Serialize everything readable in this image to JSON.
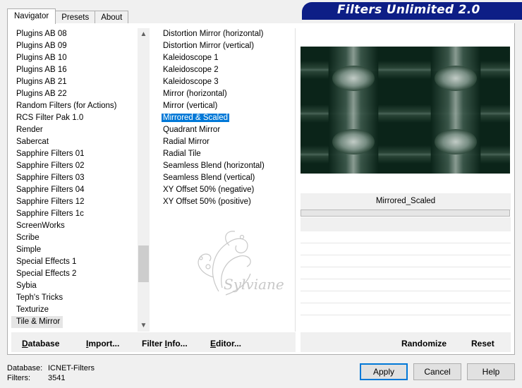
{
  "tabs": [
    {
      "label": "Navigator"
    },
    {
      "label": "Presets"
    },
    {
      "label": "About"
    }
  ],
  "app_title": "Filters Unlimited 2.0",
  "categories": [
    "Plugins AB 08",
    "Plugins AB 09",
    "Plugins AB 10",
    "Plugins AB 16",
    "Plugins AB 21",
    "Plugins AB 22",
    "Random Filters (for Actions)",
    "RCS Filter Pak 1.0",
    "Render",
    "Sabercat",
    "Sapphire Filters 01",
    "Sapphire Filters 02",
    "Sapphire Filters 03",
    "Sapphire Filters 04",
    "Sapphire Filters 12",
    "Sapphire Filters 1c",
    "ScreenWorks",
    "Scribe",
    "Simple",
    "Special Effects 1",
    "Special Effects 2",
    "Sybia",
    "Teph's Tricks",
    "Texturize",
    "Tile & Mirror"
  ],
  "selected_category": "Tile & Mirror",
  "filters": [
    "Distortion Mirror (horizontal)",
    "Distortion Mirror (vertical)",
    "Kaleidoscope 1",
    "Kaleidoscope 2",
    "Kaleidoscope 3",
    "Mirror (horizontal)",
    "Mirror (vertical)",
    "Mirrored & Scaled",
    "Quadrant Mirror",
    "Radial Mirror",
    "Radial Tile",
    "Seamless Blend (horizontal)",
    "Seamless Blend (vertical)",
    "XY Offset 50% (negative)",
    "XY Offset 50% (positive)"
  ],
  "selected_filter": "Mirrored & Scaled",
  "watermark_text": "Sylviane",
  "filter_name_display": "Mirrored_Scaled",
  "buttons": {
    "database": {
      "u": "D",
      "rest": "atabase"
    },
    "import": {
      "u": "I",
      "rest": "mport..."
    },
    "filter_info": {
      "pre": "Filter ",
      "u": "I",
      "rest": "nfo..."
    },
    "editor": {
      "u": "E",
      "rest": "ditor..."
    },
    "randomize": "Randomize",
    "reset": "Reset",
    "apply": "Apply",
    "cancel": "Cancel",
    "help": "Help"
  },
  "status": {
    "database_label": "Database:",
    "database_value": "ICNET-Filters",
    "filters_label": "Filters:",
    "filters_value": "3541"
  },
  "colors": {
    "banner": "#0d1e86",
    "selection": "#0078d7",
    "preview_dark": "#0b2419"
  }
}
